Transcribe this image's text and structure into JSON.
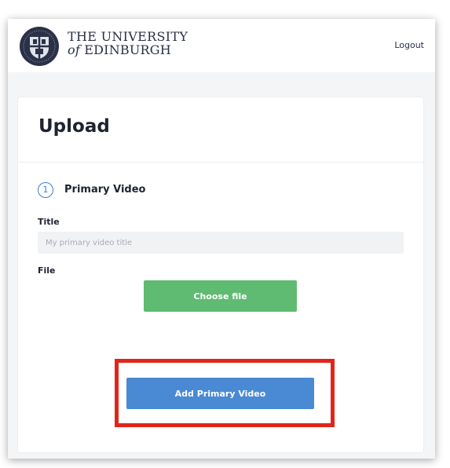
{
  "header": {
    "university_line1": "THE UNIVERSITY",
    "university_line2_prefix": "of",
    "university_line2_suffix": "EDINBURGH",
    "logout_label": "Logout"
  },
  "upload": {
    "title": "Upload",
    "step_number": "1",
    "step_title": "Primary Video",
    "title_label": "Title",
    "title_placeholder": "My primary video title",
    "title_value": "",
    "file_label": "File",
    "choose_file_label": "Choose file",
    "add_button_label": "Add Primary Video"
  },
  "colors": {
    "accent_blue": "#4a8ad4",
    "choose_file_green": "#5fba72",
    "highlight_red": "#e0251b"
  }
}
